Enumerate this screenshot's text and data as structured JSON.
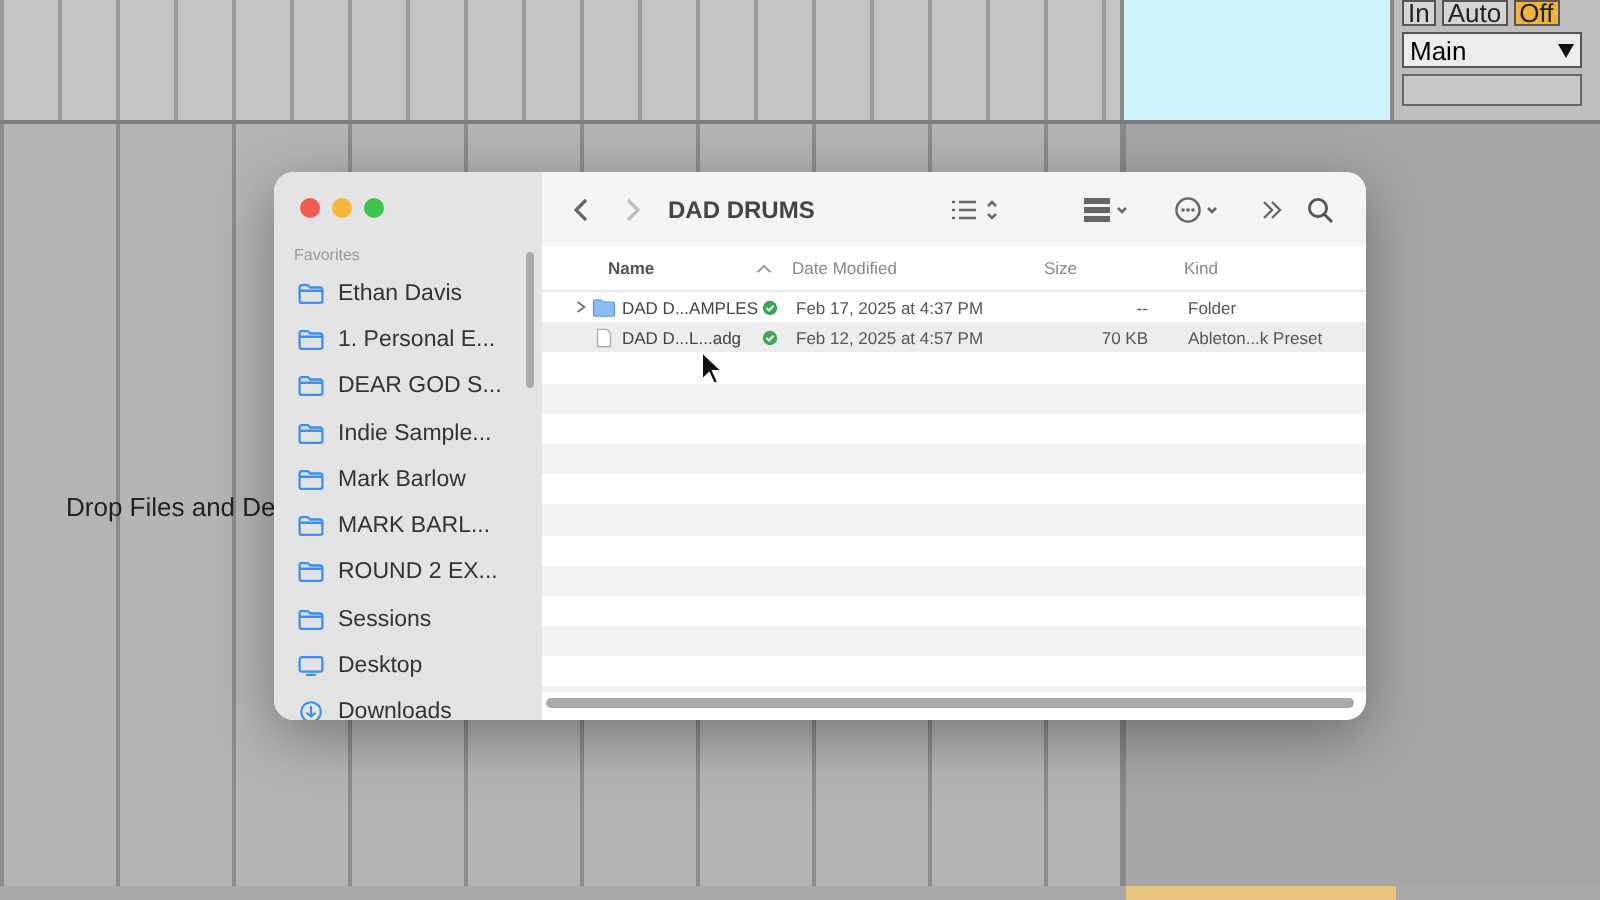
{
  "daw": {
    "drop_hint": "Drop Files and De",
    "monitor_buttons": [
      {
        "label": "In",
        "selected": false
      },
      {
        "label": "Auto",
        "selected": false
      },
      {
        "label": "Off",
        "selected": true
      }
    ],
    "output_select": "Main"
  },
  "finder": {
    "title": "DAD DRUMS",
    "sidebar": {
      "section": "Favorites",
      "items": [
        {
          "label": "Ethan Davis",
          "kind": "folder"
        },
        {
          "label": "1. Personal E...",
          "kind": "folder"
        },
        {
          "label": "DEAR GOD S...",
          "kind": "folder"
        },
        {
          "label": "Indie Sample...",
          "kind": "folder"
        },
        {
          "label": "Mark Barlow",
          "kind": "folder"
        },
        {
          "label": "MARK BARL...",
          "kind": "folder"
        },
        {
          "label": "ROUND 2 EX...",
          "kind": "folder"
        },
        {
          "label": "Sessions",
          "kind": "folder"
        },
        {
          "label": "Desktop",
          "kind": "desktop"
        },
        {
          "label": "Downloads",
          "kind": "downloads"
        }
      ]
    },
    "columns": [
      "Name",
      "Date Modified",
      "Size",
      "Kind"
    ],
    "rows": [
      {
        "name": "DAD D...AMPLES",
        "kind": "folder",
        "expandable": true,
        "date": "Feb 17, 2025 at 4:37 PM",
        "size": "--",
        "kind_label": "Folder",
        "synced": true,
        "selected": false
      },
      {
        "name": "DAD D...L...adg",
        "kind": "file",
        "expandable": false,
        "date": "Feb 12, 2025 at 4:57 PM",
        "size": "70 KB",
        "kind_label": "Ableton...k Preset",
        "synced": true,
        "selected": true
      }
    ]
  }
}
